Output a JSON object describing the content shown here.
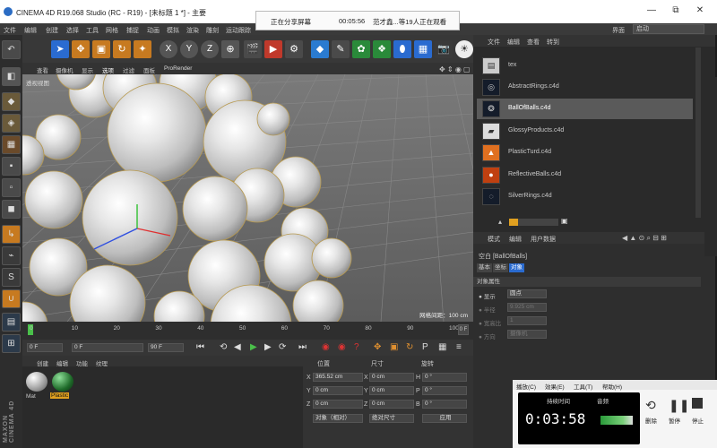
{
  "window": {
    "title": "CINEMA 4D R19.068 Studio (RC - R19) - [未标题 1 *] - 主要",
    "minimize": "—",
    "maximize": "⧉",
    "restore": "▢",
    "close": "✕"
  },
  "share_bar": {
    "status": "正在分享屏幕",
    "time": "00:05:56",
    "viewers": "范才鑫...等19人正在观看"
  },
  "menubar": [
    "文件",
    "编辑",
    "创建",
    "选择",
    "工具",
    "网格",
    "捕捉",
    "动画",
    "模拟",
    "渲染",
    "雕刻",
    "运动跟踪"
  ],
  "interface_label": "界面",
  "interface_value": "启动",
  "viewport": {
    "menu": [
      "查看",
      "摄像机",
      "显示",
      "选项",
      "过滤",
      "面板",
      "ProRender"
    ],
    "camera_label": "透视视图",
    "grid_spacing": "网格间距：100 cm",
    "axis_colors": {
      "x": "#e03030",
      "y": "#30c030",
      "z": "#3050e0"
    }
  },
  "timeline": {
    "ticks": [
      "0",
      "10",
      "20",
      "30",
      "40",
      "50",
      "60",
      "70",
      "80",
      "90",
      "100"
    ],
    "frame_start": "0 F",
    "frame_current": "0 F",
    "frame_end": "90 F",
    "frame_end_total": "90 F",
    "frame_indicator": "0 F",
    "min_field": "0 F"
  },
  "material_manager": {
    "menu": [
      "创建",
      "编辑",
      "功能",
      "纹理"
    ],
    "materials": [
      {
        "name": "Mat",
        "color": "#9c9c9c"
      },
      {
        "name": "Plastic",
        "color": "#1f6b2a"
      }
    ]
  },
  "coordinates": {
    "headers": [
      "位置",
      "尺寸",
      "旋转"
    ],
    "rows": [
      {
        "axis": "X",
        "pos": "365.52 cm",
        "size_axis": "X",
        "size": "0 cm",
        "rot_axis": "H",
        "rot": "0 °"
      },
      {
        "axis": "Y",
        "pos": "0 cm",
        "size_axis": "Y",
        "size": "0 cm",
        "rot_axis": "P",
        "rot": "0 °"
      },
      {
        "axis": "Z",
        "pos": "0 cm",
        "size_axis": "Z",
        "size": "0 cm",
        "rot_axis": "B",
        "rot": "0 °"
      }
    ],
    "mode_object": "对象（相对）",
    "mode_size": "绝对尺寸",
    "apply": "应用"
  },
  "content_browser": {
    "menu": [
      "文件",
      "编辑",
      "查看",
      "转到"
    ],
    "items": [
      {
        "name": "tex",
        "icon": "folder-icon"
      },
      {
        "name": "AbstractRings.c4d",
        "icon": "rings-icon"
      },
      {
        "name": "BallOfBalls.c4d",
        "icon": "balls-icon",
        "selected": true
      },
      {
        "name": "GlossyProducts.c4d",
        "icon": "products-icon"
      },
      {
        "name": "PlasticTurd.c4d",
        "icon": "plastic-icon"
      },
      {
        "name": "ReflectiveBalls.c4d",
        "icon": "reflective-icon"
      },
      {
        "name": "SilverRings.c4d",
        "icon": "silver-icon"
      }
    ]
  },
  "attributes": {
    "menu": [
      "模式",
      "编辑",
      "用户数据"
    ],
    "object_title": "空白 [BallOfBalls]",
    "tabs": [
      "基本",
      "坐标",
      "对象"
    ],
    "section": "对象属性",
    "fields": [
      {
        "label": "显示",
        "value": "圆点"
      },
      {
        "label": "半径",
        "value": "9.925 cm"
      },
      {
        "label": "宽高比",
        "value": "1"
      },
      {
        "label": "方向",
        "value": "摄像机"
      }
    ]
  },
  "maxon_logo": "MAXON CINEMA 4D",
  "stopwatch": {
    "menu": [
      "播放(C)",
      "效果(E)",
      "工具(T)",
      "帮助(H)"
    ],
    "elapsed_label": "持续时间",
    "elapsed": "0:03:58",
    "audio_label": "音频",
    "buttons": [
      "删除",
      "暂停",
      "停止"
    ]
  }
}
